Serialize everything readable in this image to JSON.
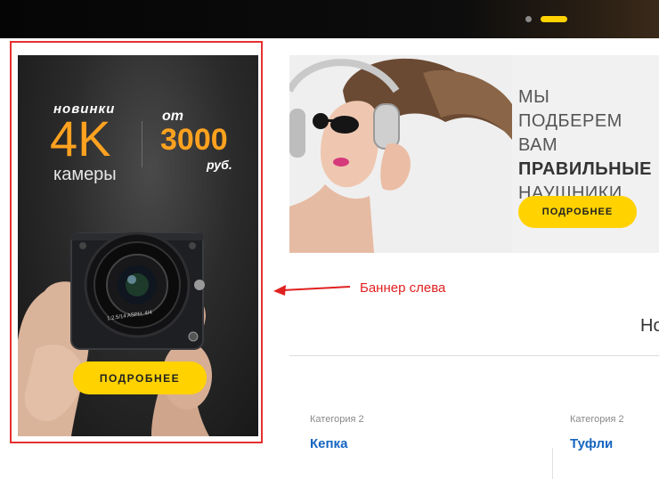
{
  "slider": {
    "dots": [
      "inactive",
      "active"
    ],
    "accent": "#ffd200"
  },
  "left_banner": {
    "line1": "новинки",
    "big": "4K",
    "line2": "камеры",
    "prefix": "от",
    "price": "3000",
    "currency": "руб.",
    "button": "ПОДРОБНЕЕ",
    "lens_text": "1:2.5/14 ASPH. 4/4",
    "accent": "#ffa21f"
  },
  "annotation": {
    "label": "Баннер слева",
    "color": "#e02020"
  },
  "right_banner": {
    "line1": "МЫ",
    "line2": "ПОДБЕРЕМ ВАМ",
    "line3": "ПРАВИЛЬНЫЕ",
    "line4": "НАУШНИКИ",
    "button": "ПОДРОБНЕЕ"
  },
  "section": {
    "title_partial": "Но"
  },
  "products": [
    {
      "category": "Категория 2",
      "name": "Кепка"
    },
    {
      "category": "Категория 2",
      "name": "Туфли"
    }
  ]
}
